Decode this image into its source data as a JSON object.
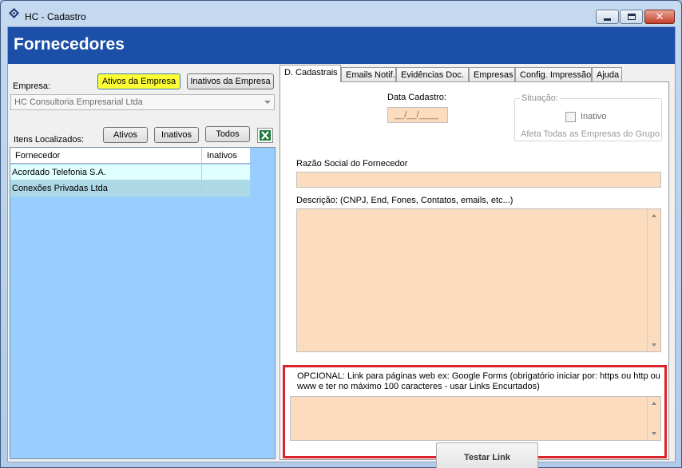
{
  "window": {
    "title": "HC - Cadastro"
  },
  "header": {
    "title": "Fornecedores"
  },
  "left": {
    "empresa_label": "Empresa:",
    "btn_ativos_empresa": "Ativos da Empresa",
    "btn_inativos_empresa": "Inativos da Empresa",
    "empresa_selected": "HC Consultoria Empresarial Ltda",
    "itens_label": "Itens Localizados:",
    "btn_ativos": "Ativos",
    "btn_inativos": "Inativos",
    "btn_todos": "Todos",
    "grid": {
      "columns": [
        "Fornecedor",
        "Inativos"
      ],
      "rows": [
        {
          "fornecedor": "Acordado Telefonia S.A.",
          "inativos": ""
        },
        {
          "fornecedor": "Conexões Privadas Ltda",
          "inativos": ""
        }
      ]
    }
  },
  "tabs": [
    {
      "label": "D. Cadastrais"
    },
    {
      "label": "Emails Notif."
    },
    {
      "label": "Evidências Doc."
    },
    {
      "label": "Empresas"
    },
    {
      "label": "Config. Impressão"
    },
    {
      "label": "Ajuda"
    }
  ],
  "form": {
    "data_cadastro_label": "Data Cadastro:",
    "data_cadastro_value": "__/__/____",
    "situacao_title": "Situação:",
    "inativo_label": "Inativo",
    "situacao_note": "Afeta Todas as Empresas do Grupo",
    "razao_label": "Razão Social do Fornecedor",
    "razao_value": "",
    "descricao_label": "Descrição: (CNPJ, End, Fones, Contatos, emails, etc...)",
    "descricao_value": "",
    "link_label": "OPCIONAL: Link para páginas web ex: Google Forms (obrigatório iniciar por: https ou http ou www  e ter no máximo 100 caracteres - usar Links Encurtados)",
    "link_value": "",
    "test_button": "Testar Link"
  },
  "colors": {
    "header_bg": "#1b4fa8",
    "field_bg": "#fcdcbe",
    "highlight_border": "#d8232a",
    "active_button": "#ffff33",
    "grid_bg": "#99ccff"
  }
}
